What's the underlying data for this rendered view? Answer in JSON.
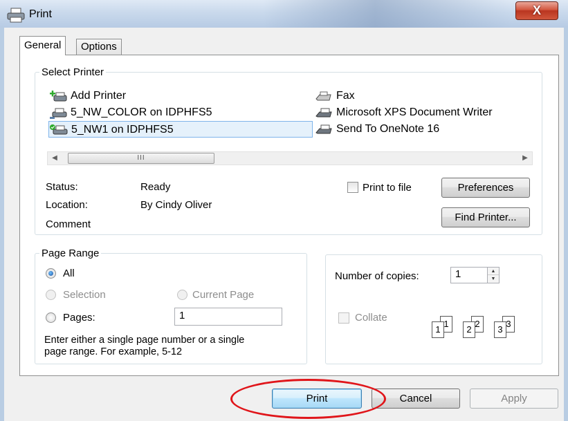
{
  "window": {
    "title": "Print",
    "close_label": "X"
  },
  "tabs": [
    {
      "label": "General",
      "active": true
    },
    {
      "label": "Options",
      "active": false
    }
  ],
  "select_printer": {
    "legend": "Select Printer",
    "printers": [
      {
        "label": "Add Printer",
        "icon": "add-printer-icon",
        "selected": false
      },
      {
        "label": "5_NW_COLOR on IDPHFS5",
        "icon": "network-printer-icon",
        "selected": false
      },
      {
        "label": "5_NW1 on IDPHFS5",
        "icon": "default-network-printer-icon",
        "selected": true
      },
      {
        "label": "Fax",
        "icon": "fax-icon",
        "selected": false
      },
      {
        "label": "Microsoft XPS Document Writer",
        "icon": "printer-icon",
        "selected": false
      },
      {
        "label": "Send To OneNote 16",
        "icon": "printer-icon",
        "selected": false
      }
    ],
    "scroll_thumb_grip": "III",
    "status_label": "Status:",
    "status_value": "Ready",
    "location_label": "Location:",
    "location_value": "By Cindy Oliver",
    "comment_label": "Comment",
    "print_to_file_label": "Print to file",
    "print_to_file_checked": false,
    "preferences_label": "Preferences",
    "find_printer_label": "Find Printer..."
  },
  "page_range": {
    "legend": "Page Range",
    "all_label": "All",
    "selection_label": "Selection",
    "current_page_label": "Current Page",
    "pages_label": "Pages:",
    "pages_value": "1",
    "selected_option": "All",
    "help_text_line1": "Enter either a single page number or a single",
    "help_text_line2": "page range.  For example, 5-12"
  },
  "copies": {
    "label": "Number of copies:",
    "value": "1",
    "collate_label": "Collate",
    "collate_checked": false,
    "collate_pages": [
      "1",
      "1",
      "2",
      "2",
      "3",
      "3"
    ]
  },
  "footer": {
    "print_label": "Print",
    "cancel_label": "Cancel",
    "apply_label": "Apply"
  },
  "colors": {
    "highlight_callout": "#e0151a",
    "selection_bg": "#e5f1fb",
    "default_button": "#3c7fb1"
  }
}
